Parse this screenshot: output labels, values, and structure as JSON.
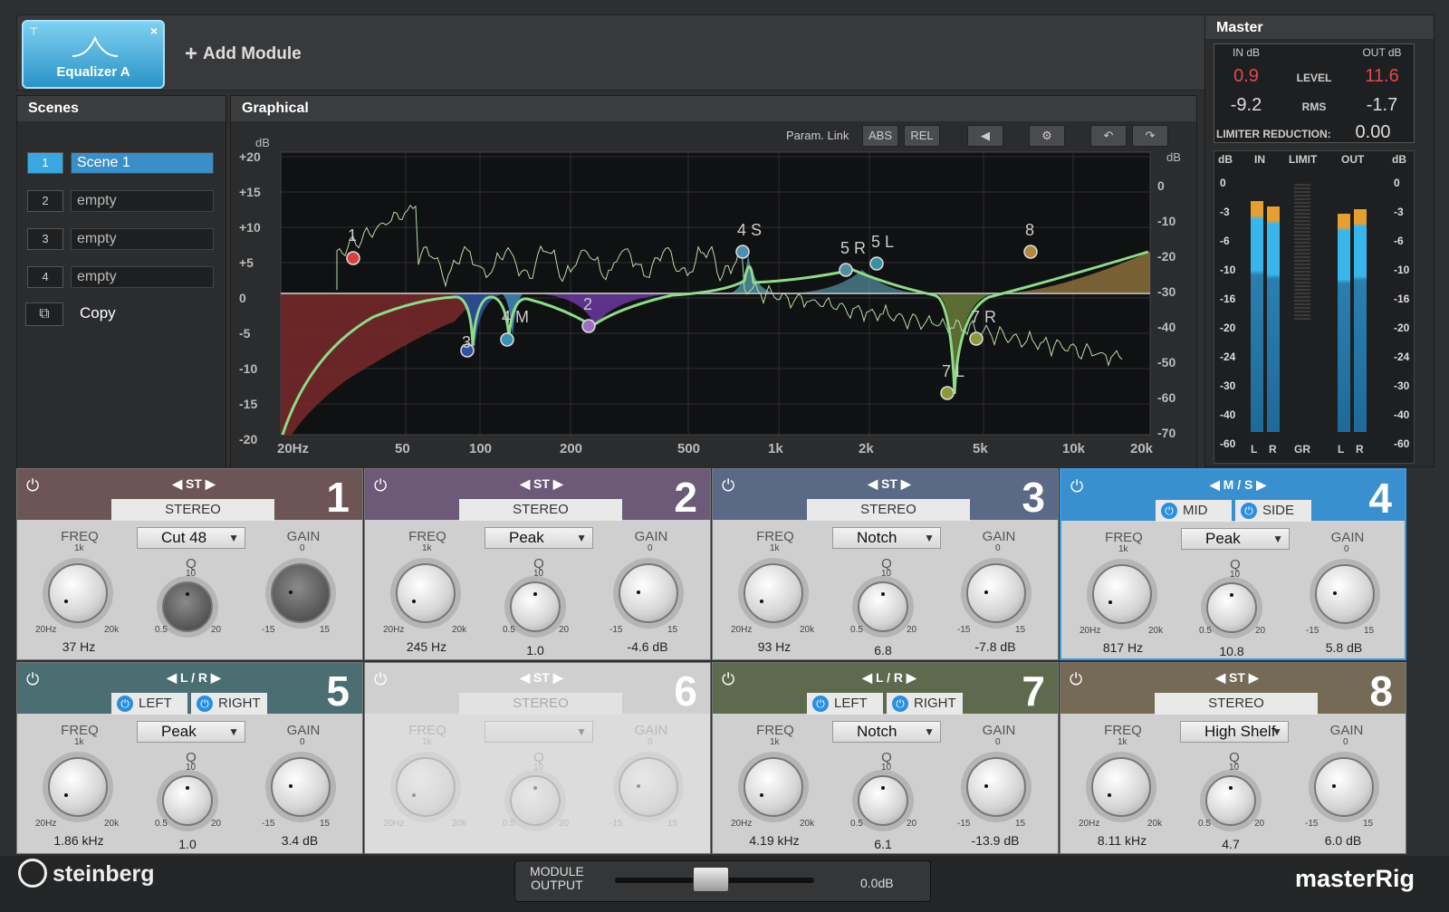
{
  "module_tab": {
    "title": "Equalizer A",
    "close": "×",
    "pin": "⊤"
  },
  "add_module": "Add Module",
  "scenes": {
    "title": "Scenes",
    "items": [
      {
        "num": "1",
        "name": "Scene 1"
      },
      {
        "num": "2",
        "name": "empty"
      },
      {
        "num": "3",
        "name": "empty"
      },
      {
        "num": "4",
        "name": "empty"
      }
    ],
    "copy": "Copy"
  },
  "graphical": {
    "title": "Graphical",
    "param_link": "Param. Link",
    "abs": "ABS",
    "rel": "REL",
    "db_left": "dB",
    "db_right": "dB",
    "y_left": [
      "+20",
      "+15",
      "+10",
      "+5",
      "0",
      "-5",
      "-10",
      "-15",
      "-20"
    ],
    "y_right": [
      "0",
      "-10",
      "-20",
      "-30",
      "-40",
      "-50",
      "-60",
      "-70"
    ],
    "x_labels": [
      "20Hz",
      "50",
      "100",
      "200",
      "500",
      "1k",
      "2k",
      "5k",
      "10k",
      "20k"
    ],
    "nodes": [
      "1",
      "2",
      "3",
      "4 M",
      "4 S",
      "5 R",
      "5 L",
      "7 L",
      "7 R",
      "8"
    ]
  },
  "master": {
    "title": "Master",
    "in_db": "IN dB",
    "out_db": "OUT dB",
    "level_lbl": "LEVEL",
    "rms_lbl": "RMS",
    "in_level": "0.9",
    "out_level": "11.6",
    "in_rms": "-9.2",
    "out_rms": "-1.7",
    "limiter_lbl": "LIMITER REDUCTION:",
    "limiter_val": "0.00",
    "meter_head": [
      "dB",
      "IN",
      "LIMIT",
      "OUT",
      "dB"
    ],
    "scale": [
      "0",
      "-3",
      "-6",
      "-10",
      "-16",
      "-20",
      "-24",
      "-30",
      "-40",
      "-60"
    ],
    "foot": [
      "L",
      "R",
      "GR",
      "L",
      "R"
    ],
    "levels": {
      "in_l": 0.88,
      "in_r": 0.86,
      "out_l": 0.83,
      "out_r": 0.85
    }
  },
  "bands": [
    {
      "num": "1",
      "mode": "ST",
      "ch": "STEREO",
      "type": "Cut 48",
      "freq": "37 Hz",
      "q": "",
      "gain": "",
      "color": "#6e5555"
    },
    {
      "num": "2",
      "mode": "ST",
      "ch": "STEREO",
      "type": "Peak",
      "freq": "245 Hz",
      "q": "1.0",
      "gain": "-4.6 dB",
      "color": "#6c5a78"
    },
    {
      "num": "3",
      "mode": "ST",
      "ch": "STEREO",
      "type": "Notch",
      "freq": "93 Hz",
      "q": "6.8",
      "gain": "-7.8 dB",
      "color": "#5a6a86"
    },
    {
      "num": "4",
      "mode": "M / S",
      "ch1": "MID",
      "ch2": "SIDE",
      "type": "Peak",
      "freq": "817 Hz",
      "q": "10.8",
      "gain": "5.8 dB",
      "color": "#3a8fcf"
    },
    {
      "num": "5",
      "mode": "L / R",
      "ch1": "LEFT",
      "ch2": "RIGHT",
      "type": "Peak",
      "freq": "1.86 kHz",
      "q": "1.0",
      "gain": "3.4 dB",
      "color": "#4a6e72"
    },
    {
      "num": "6",
      "mode": "ST",
      "ch": "STEREO",
      "type": "",
      "freq": "",
      "q": "",
      "gain": "",
      "color": "#cfcfcf"
    },
    {
      "num": "7",
      "mode": "L / R",
      "ch1": "LEFT",
      "ch2": "RIGHT",
      "type": "Notch",
      "freq": "4.19 kHz",
      "q": "6.1",
      "gain": "-13.9 dB",
      "color": "#5e6a4e"
    },
    {
      "num": "8",
      "mode": "ST",
      "ch": "STEREO",
      "type": "High Shelf",
      "freq": "8.11 kHz",
      "q": "4.7",
      "gain": "6.0 dB",
      "color": "#746a56"
    }
  ],
  "labels": {
    "freq": "FREQ",
    "q": "Q",
    "gain": "GAIN",
    "k1": "1k",
    "q10": "10",
    "g0": "0",
    "f20": "20Hz",
    "f20k": "20k",
    "q05": "0.5",
    "q20": "20",
    "gm15": "-15",
    "g15": "15"
  },
  "footer": {
    "logo": "steinberg",
    "brand": "masterRig",
    "module_output": "MODULE\nOUTPUT",
    "output_val": "0.0dB"
  }
}
